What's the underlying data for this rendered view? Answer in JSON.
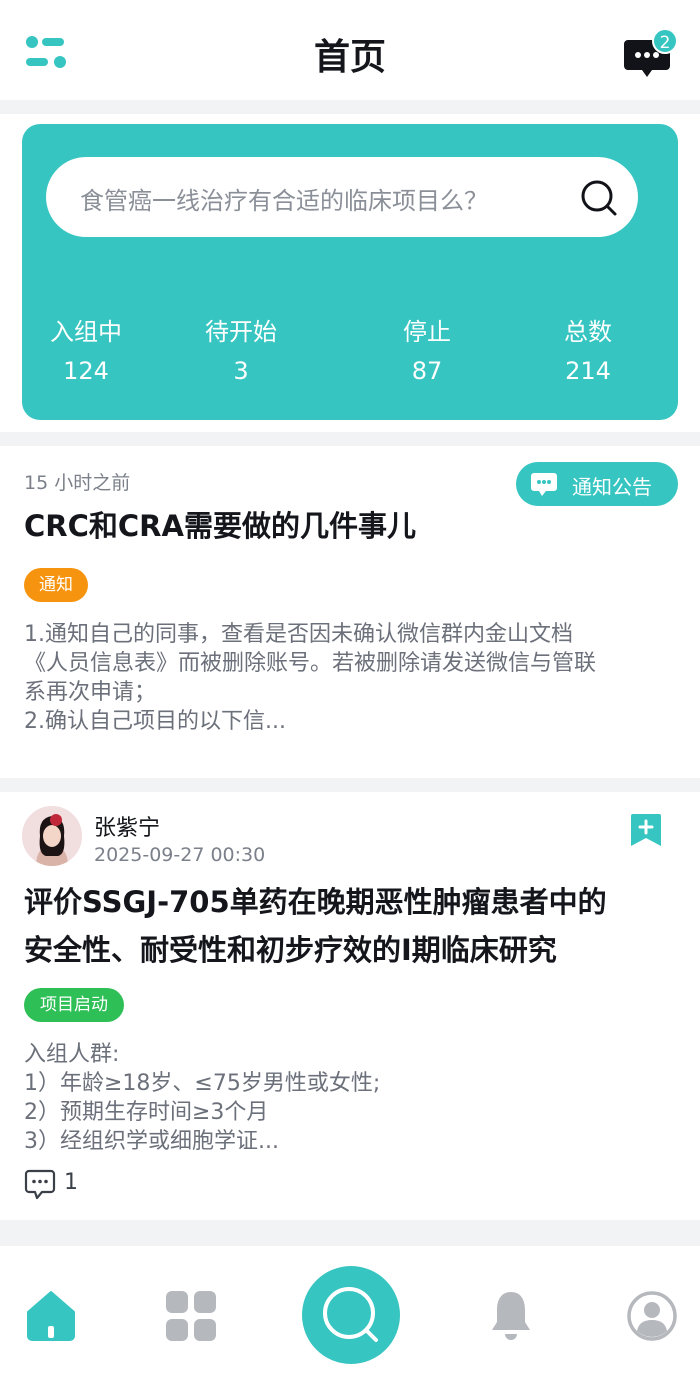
{
  "header": {
    "title": "首页",
    "message_badge": "2"
  },
  "search": {
    "placeholder": "食管癌一线治疗有合适的临床项目么？"
  },
  "stats": [
    {
      "label": "入组中",
      "value": "124"
    },
    {
      "label": "待开始",
      "value": "3"
    },
    {
      "label": "停止",
      "value": "87"
    },
    {
      "label": "总数",
      "value": "214"
    }
  ],
  "notice": {
    "time": "15 小时之前",
    "category_button": "通知公告",
    "title": "CRC和CRA需要做的几件事儿",
    "tag": "通知",
    "lines": [
      "1.通知自己的同事，查看是否因未确认微信群内金山文档",
      "《人员信息表》而被删除账号。若被删除请发送微信与管联",
      "系再次申请；",
      "2.确认自己项目的以下信..."
    ]
  },
  "post": {
    "author": "张紫宁",
    "time": "2025-09-27 00:30",
    "title_lines": [
      "评价SSGJ-705单药在晚期恶性肿瘤患者中的",
      "安全性、耐受性和初步疗效的I期临床研究"
    ],
    "tag": "项目启动",
    "lines": [
      "入组人群:",
      "1）年龄≥18岁、≤75岁男性或女性;",
      "2）预期生存时间≥3个月",
      "3）经组织学或细胞学证..."
    ],
    "comment_count": "1"
  },
  "colors": {
    "accent": "#36c5c1",
    "orange_tag": "#f7940f",
    "green_tag": "#2fbf57"
  },
  "tabbar": {
    "items": [
      "home-icon",
      "grid-icon",
      "search-icon",
      "bell-icon",
      "profile-icon"
    ]
  }
}
